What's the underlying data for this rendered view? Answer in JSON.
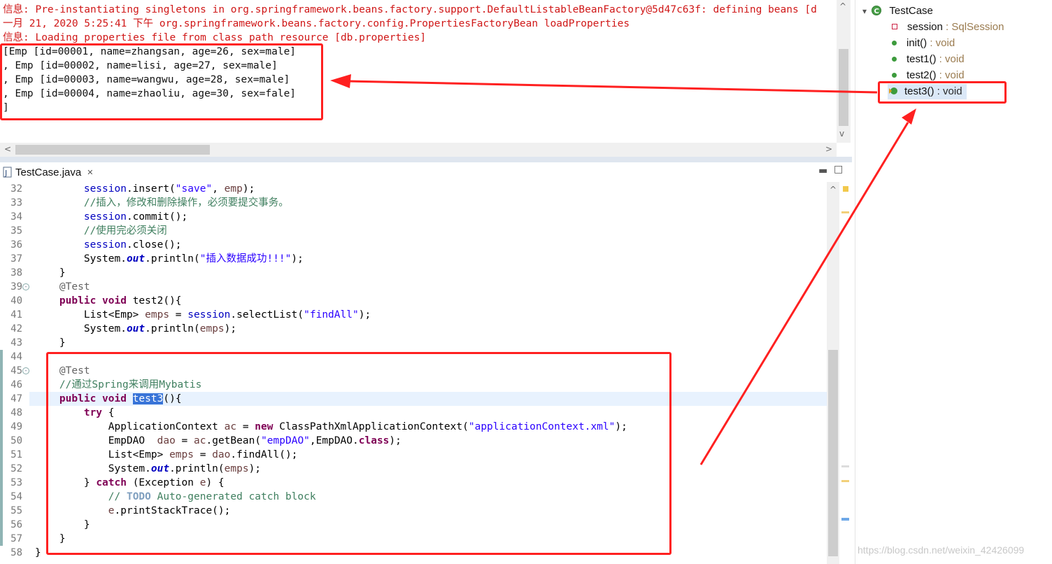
{
  "console": {
    "lines": [
      {
        "text": "信息: Pre-instantiating singletons in org.springframework.beans.factory.support.DefaultListableBeanFactory@5d47c63f: defining beans [d",
        "color": "#d01818"
      },
      {
        "text": "一月 21, 2020 5:25:41 下午 org.springframework.beans.factory.config.PropertiesFactoryBean loadProperties",
        "color": "#d01818"
      },
      {
        "text": "信息: Loading properties file from class path resource [db.properties]",
        "color": "#d01818"
      },
      {
        "text": "[Emp [id=00001, name=zhangsan, age=26, sex=male]",
        "color": "#111111"
      },
      {
        "text": ", Emp [id=00002, name=lisi, age=27, sex=male]",
        "color": "#111111"
      },
      {
        "text": ", Emp [id=00003, name=wangwu, age=28, sex=male]",
        "color": "#111111"
      },
      {
        "text": ", Emp [id=00004, name=zhaoliu, age=30, sex=fale]",
        "color": "#111111"
      },
      {
        "text": "]",
        "color": "#111111"
      }
    ]
  },
  "editor": {
    "tab_label": "TestCase.java",
    "close_glyph": "✕",
    "line_numbers": [
      "32",
      "33",
      "34",
      "35",
      "36",
      "37",
      "38",
      "39",
      "40",
      "41",
      "42",
      "43",
      "44",
      "45",
      "46",
      "47",
      "48",
      "49",
      "50",
      "51",
      "52",
      "53",
      "54",
      "55",
      "56",
      "57",
      "58"
    ]
  },
  "outline": {
    "class_name": "TestCase",
    "members": [
      {
        "name": "session",
        "type": " : SqlSession"
      },
      {
        "name": "init()",
        "type": " : void"
      },
      {
        "name": "test1()",
        "type": " : void"
      },
      {
        "name": "test2()",
        "type": " : void"
      },
      {
        "name": "test3()",
        "type": " : void"
      }
    ]
  },
  "watermark": "https://blog.csdn.net/weixin_42426099",
  "colors": {
    "annotation_red": "#ff2020",
    "selection": "#3874d8",
    "keyword": "#7f0055"
  }
}
